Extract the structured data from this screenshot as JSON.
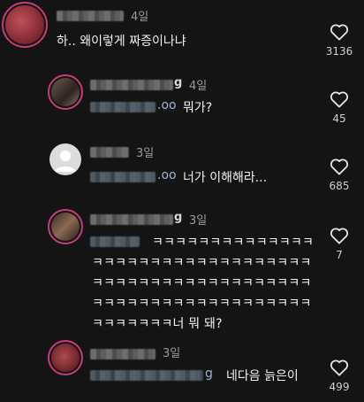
{
  "comments": [
    {
      "time": "4일",
      "text": "하.. 왜이렇게 짜증이나냐",
      "likes": "3136"
    },
    {
      "username_tail": "g",
      "time": "4일",
      "mention_tail": ".oo",
      "text": "뭐가?",
      "likes": "45"
    },
    {
      "time": "3일",
      "mention_tail": ".oo",
      "text": "너가 이해해라...",
      "likes": "685"
    },
    {
      "username_tail": "g",
      "time": "3일",
      "lines": [
        "ㅋㅋㅋㅋㅋㅋㅋㅋㅋㅋㅋㅋㅋㅋ",
        "ㅋㅋㅋㅋㅋㅋㅋㅋㅋㅋㅋㅋㅋㅋㅋㅋㅋㅋㅋ",
        "ㅋㅋㅋㅋㅋㅋㅋㅋㅋㅋㅋㅋㅋㅋㅋㅋㅋㅋㅋ",
        "ㅋㅋㅋㅋㅋㅋㅋㅋㅋㅋㅋㅋㅋㅋㅋㅋㅋㅋㅋ",
        "ㅋㅋㅋㅋㅋㅋㅋ너 뭐 돼?"
      ],
      "likes": "7"
    },
    {
      "time": "3일",
      "mention_tail": "g",
      "text": "네다음 늙은이",
      "likes": "499"
    }
  ]
}
